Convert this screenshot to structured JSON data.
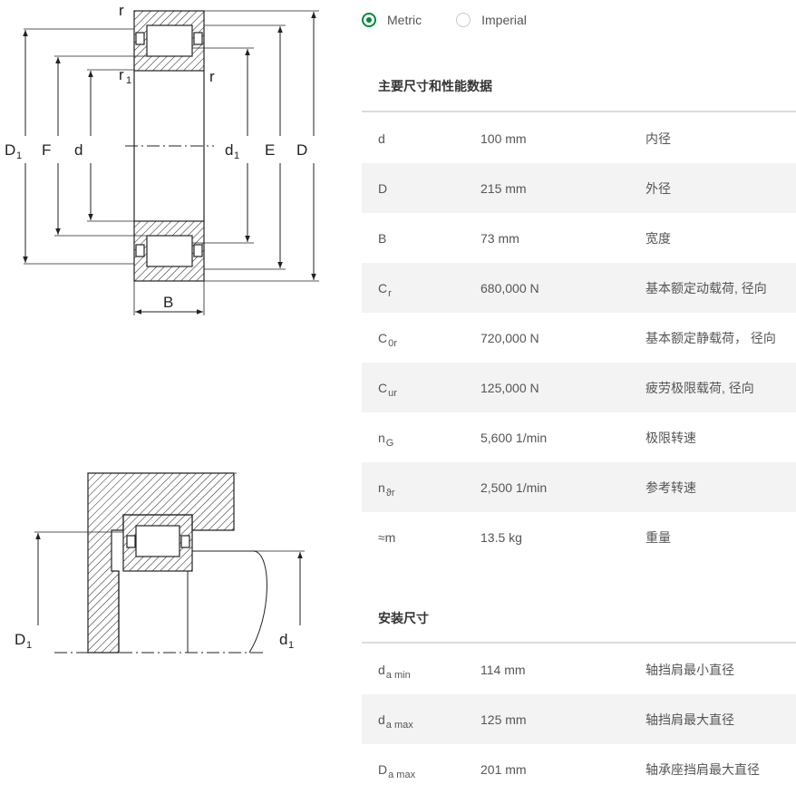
{
  "units": {
    "options": [
      {
        "label": "Metric",
        "selected": true
      },
      {
        "label": "Imperial",
        "selected": false
      }
    ],
    "accent_color": "#00893d"
  },
  "drawing_labels": {
    "r_top": "r",
    "r1": "r",
    "r1_sub": "1",
    "r_side": "r",
    "D1": "D",
    "D1_sub": "1",
    "F": "F",
    "d": "d",
    "d1": "d",
    "d1_sub": "1",
    "E": "E",
    "D": "D",
    "B": "B",
    "mount_D1": "D",
    "mount_D1_sub": "1",
    "mount_d1": "d",
    "mount_d1_sub": "1"
  },
  "main_section": {
    "title": "主要尺寸和性能数据",
    "rows": [
      {
        "sym": "d",
        "sub": "",
        "value": "100 mm",
        "desc": "内径"
      },
      {
        "sym": "D",
        "sub": "",
        "value": "215 mm",
        "desc": "外径"
      },
      {
        "sym": "B",
        "sub": "",
        "value": "73 mm",
        "desc": "宽度"
      },
      {
        "sym": "C",
        "sub": "r",
        "value": "680,000 N",
        "desc": "基本额定动载荷, 径向"
      },
      {
        "sym": "C",
        "sub": "0r",
        "value": "720,000 N",
        "desc": "基本额定静载荷， 径向"
      },
      {
        "sym": "C",
        "sub": "ur",
        "value": "125,000 N",
        "desc": "疲劳极限载荷, 径向"
      },
      {
        "sym": "n",
        "sub": "G",
        "value": "5,600 1/min",
        "desc": "极限转速"
      },
      {
        "sym": "n",
        "sub": "ϑr",
        "value": "2,500 1/min",
        "desc": "参考转速"
      },
      {
        "sym": "≈m",
        "sub": "",
        "value": "13.5 kg",
        "desc": "重量"
      }
    ]
  },
  "mount_section": {
    "title": "安装尺寸",
    "rows": [
      {
        "sym": "d",
        "sub": "a min",
        "value": "114 mm",
        "desc": "轴挡肩最小直径"
      },
      {
        "sym": "d",
        "sub": "a max",
        "value": "125 mm",
        "desc": "轴挡肩最大直径"
      },
      {
        "sym": "D",
        "sub": "a max",
        "value": "201 mm",
        "desc": "轴承座挡肩最大直径"
      }
    ]
  }
}
